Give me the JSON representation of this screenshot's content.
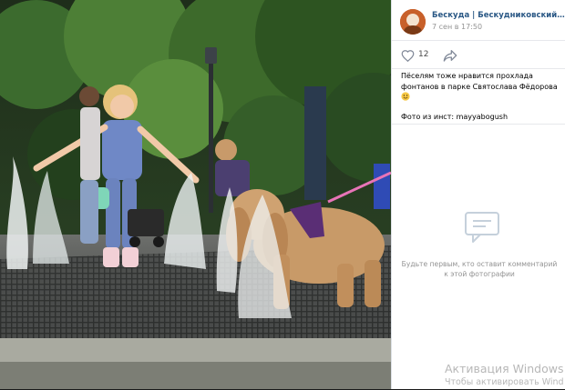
{
  "post": {
    "author": "Бескуда | Бескудниковский район ...",
    "date": "7 сен в 17:50",
    "likes": "12",
    "caption_line1": "Пёселям тоже нравится прохлада фонтанов в парке Святослава Фёдорова",
    "caption_line2": "Фото из инст: mayyabogush"
  },
  "icons": {
    "like": "heart-icon",
    "share": "share-arrow-icon",
    "comment": "comment-bubble-icon",
    "emoji": "smiling-face-emoji"
  },
  "comments": {
    "empty_text": "Будьте первым, кто оставит комментарий к этой фотографии"
  },
  "watermark": {
    "title": "Активация Windows",
    "subtitle": "Чтобы активировать Wind"
  },
  "colors": {
    "link": "#2a5885",
    "muted": "#939393",
    "avatar": "#c8602a"
  }
}
